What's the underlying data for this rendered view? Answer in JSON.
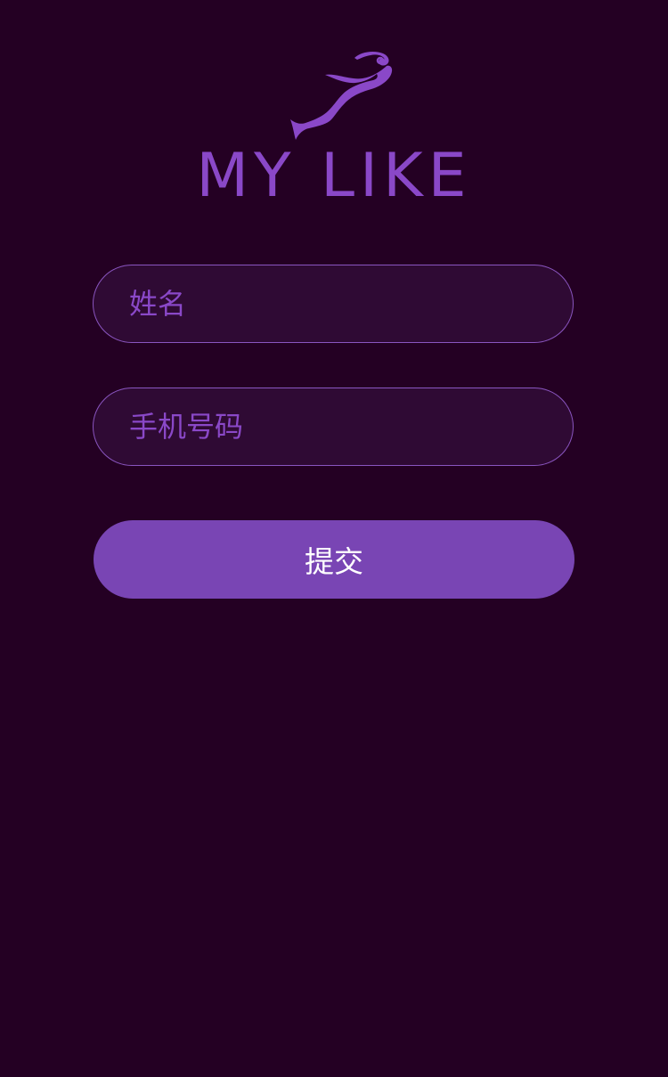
{
  "logo": {
    "icon": "mermaid-logo-icon",
    "brand": "MY LIKE"
  },
  "form": {
    "name_placeholder": "姓名",
    "name_value": "",
    "phone_placeholder": "手机号码",
    "phone_value": "",
    "submit_label": "提交"
  },
  "colors": {
    "background": "#240023",
    "accent": "#8a48c8",
    "button": "#7945b4",
    "field_background": "#2f0a34",
    "field_border": "#8a55c0"
  }
}
